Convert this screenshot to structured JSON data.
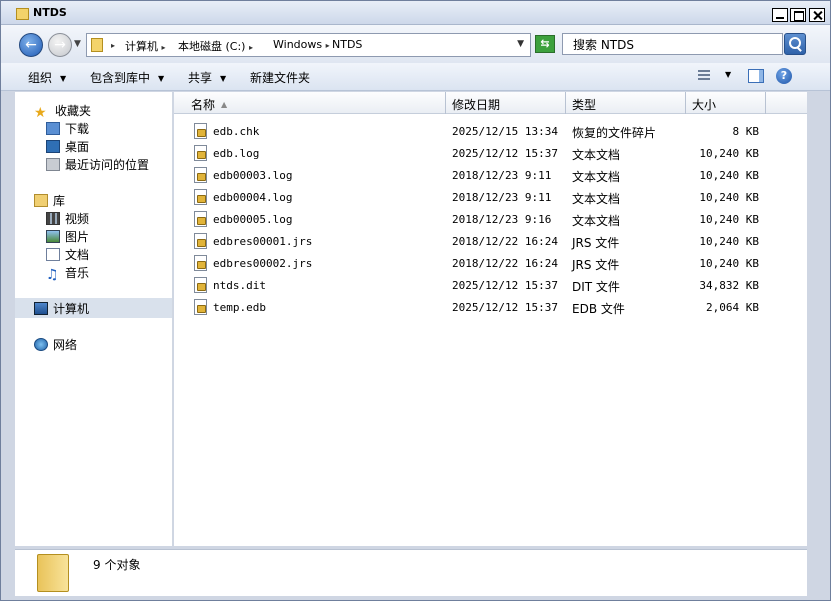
{
  "window": {
    "title": "NTDS"
  },
  "address": {
    "crumbs": [
      "计算机",
      "本地磁盘 (C:)",
      "Windows",
      "NTDS"
    ]
  },
  "search": {
    "placeholder": "搜索 NTDS"
  },
  "toolbar": {
    "organize": "组织",
    "include_in_library": "包含到库中",
    "share": "共享",
    "new_folder": "新建文件夹"
  },
  "nav": {
    "favorites": "收藏夹",
    "favorites_items": [
      "下载",
      "桌面",
      "最近访问的位置"
    ],
    "libraries": "库",
    "library_items": [
      "视频",
      "图片",
      "文档",
      "音乐"
    ],
    "computer": "计算机",
    "network": "网络"
  },
  "columns": {
    "name": "名称",
    "modified": "修改日期",
    "type": "类型",
    "size": "大小"
  },
  "files": [
    {
      "name": "edb.chk",
      "modified": "2025/12/15 13:34",
      "type": "恢复的文件碎片",
      "size": "8 KB"
    },
    {
      "name": "edb.log",
      "modified": "2025/12/12 15:37",
      "type": "文本文档",
      "size": "10,240 KB"
    },
    {
      "name": "edb00003.log",
      "modified": "2018/12/23 9:11",
      "type": "文本文档",
      "size": "10,240 KB"
    },
    {
      "name": "edb00004.log",
      "modified": "2018/12/23 9:11",
      "type": "文本文档",
      "size": "10,240 KB"
    },
    {
      "name": "edb00005.log",
      "modified": "2018/12/23 9:16",
      "type": "文本文档",
      "size": "10,240 KB"
    },
    {
      "name": "edbres00001.jrs",
      "modified": "2018/12/22 16:24",
      "type": "JRS 文件",
      "size": "10,240 KB"
    },
    {
      "name": "edbres00002.jrs",
      "modified": "2018/12/22 16:24",
      "type": "JRS 文件",
      "size": "10,240 KB"
    },
    {
      "name": "ntds.dit",
      "modified": "2025/12/12 15:37",
      "type": "DIT 文件",
      "size": "34,832 KB"
    },
    {
      "name": "temp.edb",
      "modified": "2025/12/12 15:37",
      "type": "EDB 文件",
      "size": "2,064 KB"
    }
  ],
  "status": {
    "text": "9 个对象"
  }
}
